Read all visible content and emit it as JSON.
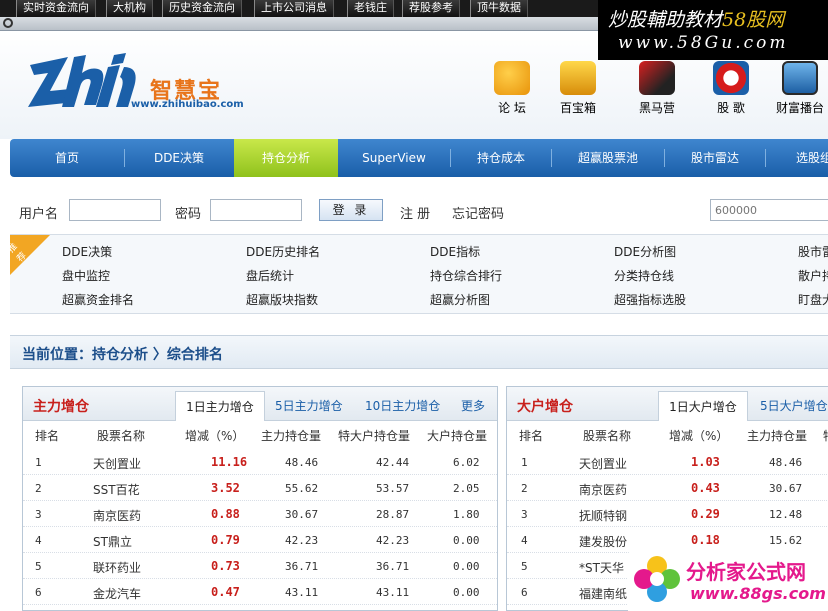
{
  "top_tabs": [
    "实时资金流向",
    "大机构",
    "历史资金流向",
    "上市公司消息",
    "老钱庄",
    "荐股参考",
    "顶牛数据"
  ],
  "watermark_top": {
    "line1_a": "炒股輔助教材",
    "line1_b": "58股网",
    "line2": "www.58Gu.com"
  },
  "logo": {
    "cn": "智慧宝",
    "url": "www.zhihuibao.com"
  },
  "header_icons": [
    {
      "label": "论 坛",
      "icon": "forum-icon"
    },
    {
      "label": "百宝箱",
      "icon": "treasure-chest-icon"
    },
    {
      "label": "黑马营",
      "icon": "dark-horse-icon"
    },
    {
      "label": "股 歌",
      "icon": "stock-song-icon"
    },
    {
      "label": "财富播台",
      "icon": "wealth-broadcast-icon"
    }
  ],
  "nav": [
    "首页",
    "DDE决策",
    "持仓分析",
    "SuperView",
    "持仓成本",
    "超赢股票池",
    "股市雷达",
    "选股组"
  ],
  "nav_active": "持仓分析",
  "login": {
    "user_label": "用户名",
    "user_value": "",
    "pass_label": "密码",
    "pass_value": "",
    "login_button": "登 录",
    "register": "注 册",
    "forgot": "忘记密码",
    "stock_input_placeholder": "600000"
  },
  "links_badge": "推荐",
  "links": [
    [
      "DDE决策",
      "DDE历史排名",
      "DDE指标",
      "DDE分析图",
      "股市雷"
    ],
    [
      "盘中监控",
      "盘后统计",
      "持仓综合排行",
      "分类持仓线",
      "散户持"
    ],
    [
      "超赢资金排名",
      "超赢版块指数",
      "超赢分析图",
      "超强指标选股",
      "盯盘大"
    ]
  ],
  "breadcrumb": "当前位置：持仓分析 〉综合排名",
  "left_panel": {
    "title": "主力增仓",
    "tabs": [
      "1日主力增仓",
      "5日主力增仓",
      "10日主力增仓",
      "更多"
    ],
    "headers": [
      "排名",
      "股票名称",
      "增减（%）",
      "主力持仓量",
      "特大户持仓量",
      "大户持仓量"
    ],
    "rows": [
      [
        "1",
        "天创置业",
        "11.16",
        "48.46",
        "42.44",
        "6.02"
      ],
      [
        "2",
        "SST百花",
        "3.52",
        "55.62",
        "53.57",
        "2.05"
      ],
      [
        "3",
        "南京医药",
        "0.88",
        "30.67",
        "28.87",
        "1.80"
      ],
      [
        "4",
        "ST鼎立",
        "0.79",
        "42.23",
        "42.23",
        "0.00"
      ],
      [
        "5",
        "联环药业",
        "0.73",
        "36.71",
        "36.71",
        "0.00"
      ],
      [
        "6",
        "金龙汽车",
        "0.47",
        "43.11",
        "43.11",
        "0.00"
      ]
    ]
  },
  "right_panel": {
    "title": "大户增仓",
    "tabs": [
      "1日大户增仓",
      "5日大户增仓"
    ],
    "headers": [
      "排名",
      "股票名称",
      "增减（%）",
      "主力持仓量",
      "特"
    ],
    "rows": [
      [
        "1",
        "天创置业",
        "1.03",
        "48.46"
      ],
      [
        "2",
        "南京医药",
        "0.43",
        "30.67"
      ],
      [
        "3",
        "抚顺特钢",
        "0.29",
        "12.48"
      ],
      [
        "4",
        "建发股份",
        "0.18",
        "15.62"
      ],
      [
        "5",
        "*ST天华",
        "",
        ""
      ],
      [
        "6",
        "福建南纸",
        "",
        ""
      ]
    ]
  },
  "watermark_bottom": {
    "line1": "分析家公式网",
    "line2": "www.88gs.com"
  },
  "colors": {
    "nav_blue": "#1a5ea8",
    "nav_active": "#8fc21c",
    "accent_red": "#c8201c",
    "logo_orange": "#e8741a"
  }
}
